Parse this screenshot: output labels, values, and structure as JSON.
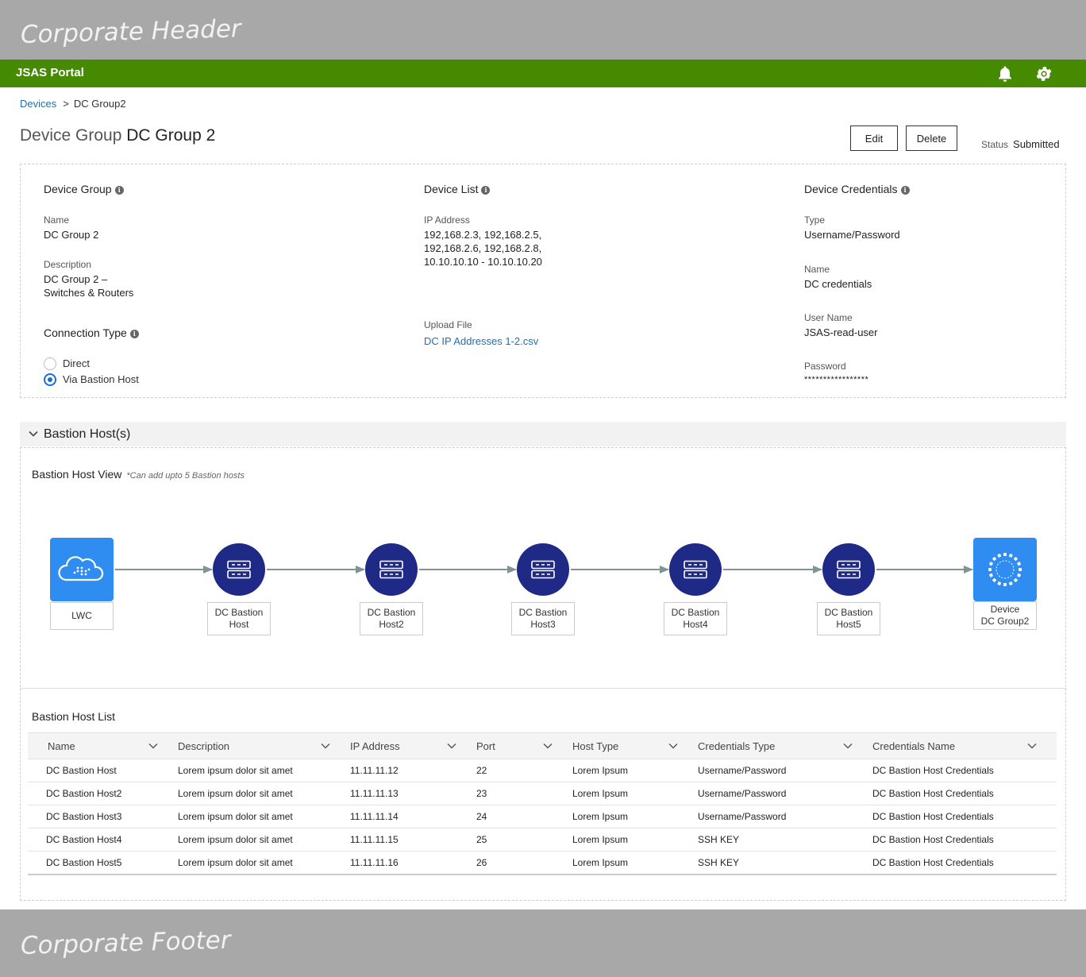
{
  "corporate": {
    "header": "Corporate Header",
    "footer": "Corporate Footer"
  },
  "app": {
    "title": "JSAS Portal",
    "icons": [
      "bell-icon",
      "gear-icon"
    ]
  },
  "breadcrumb": {
    "root": "Devices",
    "separator": ">",
    "current": "DC Group2"
  },
  "page": {
    "title_prefix": "Device Group",
    "title_name": "DC Group 2",
    "edit_label": "Edit",
    "delete_label": "Delete",
    "status_label": "Status",
    "status_value": "Submitted"
  },
  "device_group": {
    "title": "Device Group",
    "name_label": "Name",
    "name_value": "DC Group 2",
    "description_label": "Description",
    "description_line1": "DC Group 2 –",
    "description_line2": "Switches & Routers"
  },
  "connection": {
    "title": "Connection Type",
    "options": [
      {
        "label": "Direct",
        "selected": false
      },
      {
        "label": "Via Bastion Host",
        "selected": true
      }
    ]
  },
  "device_list": {
    "title": "Device List",
    "ip_label": "IP Address",
    "ip_line1": "192,168.2.3, 192,168.2.5,",
    "ip_line2": "192,168.2.6, 192,168.2.8,",
    "ip_line3": "10.10.10.10 - 10.10.10.20",
    "upload_label": "Upload File",
    "upload_file": "DC IP Addresses 1-2.csv"
  },
  "credentials": {
    "title": "Device Credentials",
    "type_label": "Type",
    "type_value": "Username/Password",
    "name_label": "Name",
    "name_value": "DC credentials",
    "user_label": "User Name",
    "user_value": "JSAS-read-user",
    "password_label": "Password",
    "password_value": "*****************"
  },
  "bastion": {
    "section_title": "Bastion Host(s)",
    "view_title": "Bastion Host View",
    "view_note": "*Can add upto 5 Bastion hosts",
    "colors": {
      "node": "#1f2a86",
      "endpoint": "#2f8cf0",
      "arrow": "#7f9595"
    },
    "nodes": [
      {
        "type": "cloud",
        "icon": "cloud-icon",
        "line1": "LWC",
        "line2": ""
      },
      {
        "type": "server",
        "icon": "server-icon",
        "line1": "DC Bastion",
        "line2": "Host"
      },
      {
        "type": "server",
        "icon": "server-icon",
        "line1": "DC Bastion",
        "line2": "Host2"
      },
      {
        "type": "server",
        "icon": "server-icon",
        "line1": "DC Bastion",
        "line2": "Host3"
      },
      {
        "type": "server",
        "icon": "server-icon",
        "line1": "DC Bastion",
        "line2": "Host4"
      },
      {
        "type": "server",
        "icon": "server-icon",
        "line1": "DC Bastion",
        "line2": "Host5"
      },
      {
        "type": "device",
        "icon": "device-group-icon",
        "line1": "Device",
        "line2": "DC Group2"
      }
    ],
    "list_title": "Bastion Host List",
    "columns": [
      "Name",
      "Description",
      "IP Address",
      "Port",
      "Host Type",
      "Credentials Type",
      "Credentials Name"
    ],
    "rows": [
      [
        "DC Bastion Host",
        "Lorem ipsum dolor sit amet",
        "11.11.11.12",
        "22",
        "Lorem Ipsum",
        "Username/Password",
        "DC Bastion Host Credentials"
      ],
      [
        "DC Bastion Host2",
        "Lorem ipsum dolor sit amet",
        "11.11.11.13",
        "23",
        "Lorem Ipsum",
        "Username/Password",
        "DC Bastion Host Credentials"
      ],
      [
        "DC Bastion Host3",
        "Lorem ipsum dolor sit amet",
        "11.11.11.14",
        "24",
        "Lorem Ipsum",
        "Username/Password",
        "DC Bastion Host Credentials"
      ],
      [
        "DC Bastion Host4",
        "Lorem ipsum dolor sit amet",
        "11.11.11.15",
        "25",
        "Lorem Ipsum",
        "SSH KEY",
        "DC Bastion Host Credentials"
      ],
      [
        "DC Bastion Host5",
        "Lorem ipsum dolor sit amet",
        "11.11.11.16",
        "26",
        "Lorem Ipsum",
        "SSH KEY",
        "DC Bastion Host Credentials"
      ]
    ]
  }
}
